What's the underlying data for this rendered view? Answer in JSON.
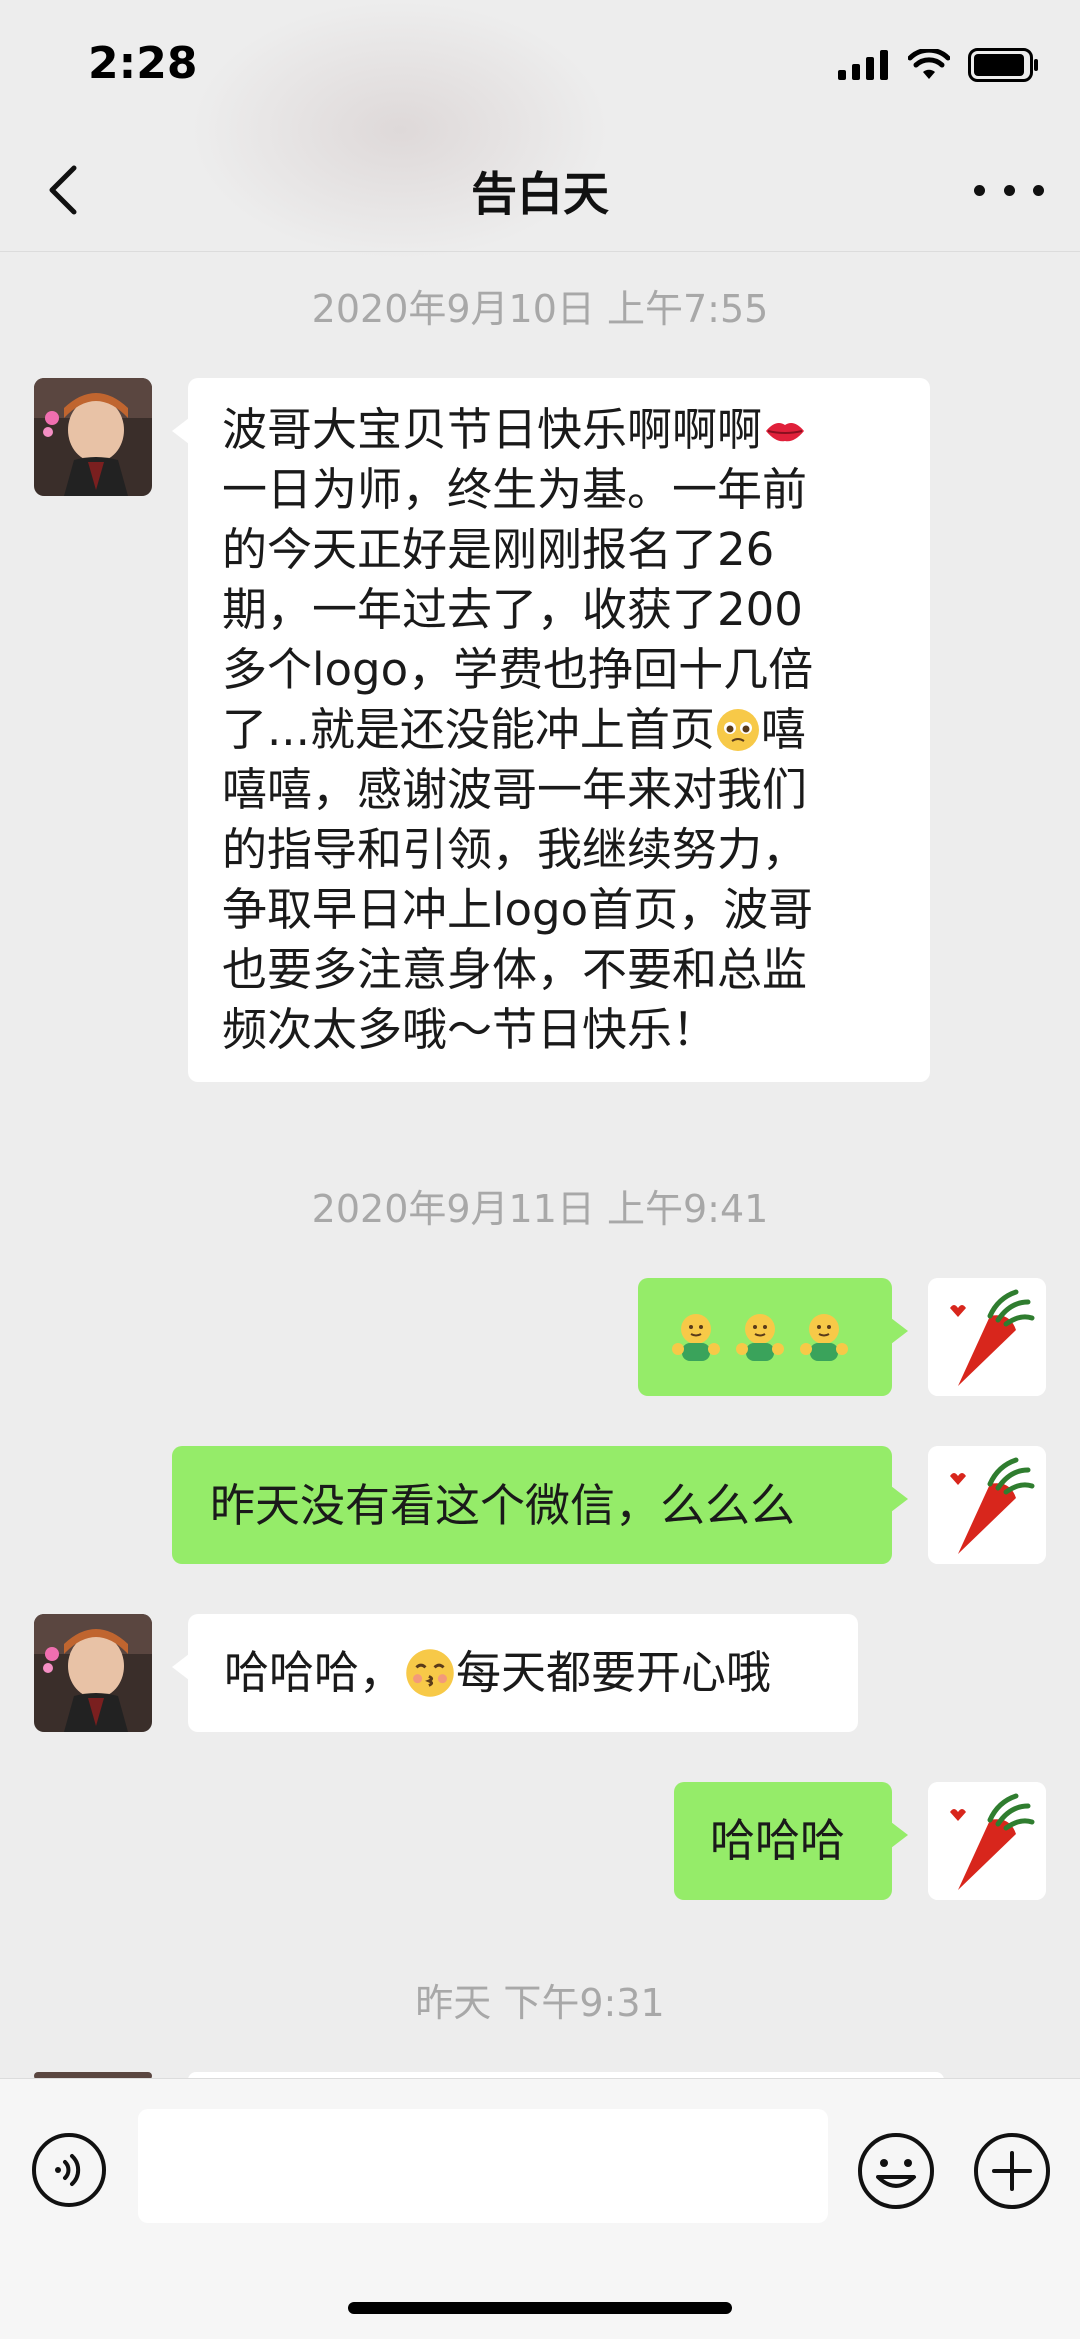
{
  "status_bar": {
    "time": "2:28"
  },
  "nav": {
    "title": "告白天"
  },
  "messages": {
    "ts1": "2020年9月10日 上午7:55",
    "m1": {
      "line1_text": "波哥大宝贝节日快乐啊啊啊",
      "line2": "一日为师，终生为基。一年前",
      "line3": "的今天正好是刚刚报名了26",
      "line4": "期，一年过去了，收获了200",
      "line5": "多个logo，学费也挣回十几倍",
      "line6_a": "了...就是还没能冲上首页",
      "line6_b": "嘻",
      "line7": "嘻嘻，感谢波哥一年来对我们",
      "line8": "的指导和引领，我继续努力，",
      "line9": "争取早日冲上logo首页，波哥",
      "line10": "也要多注意身体，不要和总监",
      "line11": "频次太多哦～节日快乐！"
    },
    "ts2": "2020年9月11日 上午9:41",
    "m3": "昨天没有看这个微信，么么么",
    "m4_a": "哈哈哈，",
    "m4_b": "每天都要开心哦",
    "m5": "哈哈哈",
    "ts3": "昨天 下午9:31"
  },
  "icons": {
    "back": "chevron-left-icon",
    "more": "ellipsis-icon",
    "voice": "voice-icon",
    "emoji": "smiley-icon",
    "plus": "plus-icon"
  },
  "colors": {
    "background": "#ededed",
    "bubble_self": "#95ec69",
    "bubble_other": "#ffffff",
    "timestamp": "#a8a8a8"
  }
}
